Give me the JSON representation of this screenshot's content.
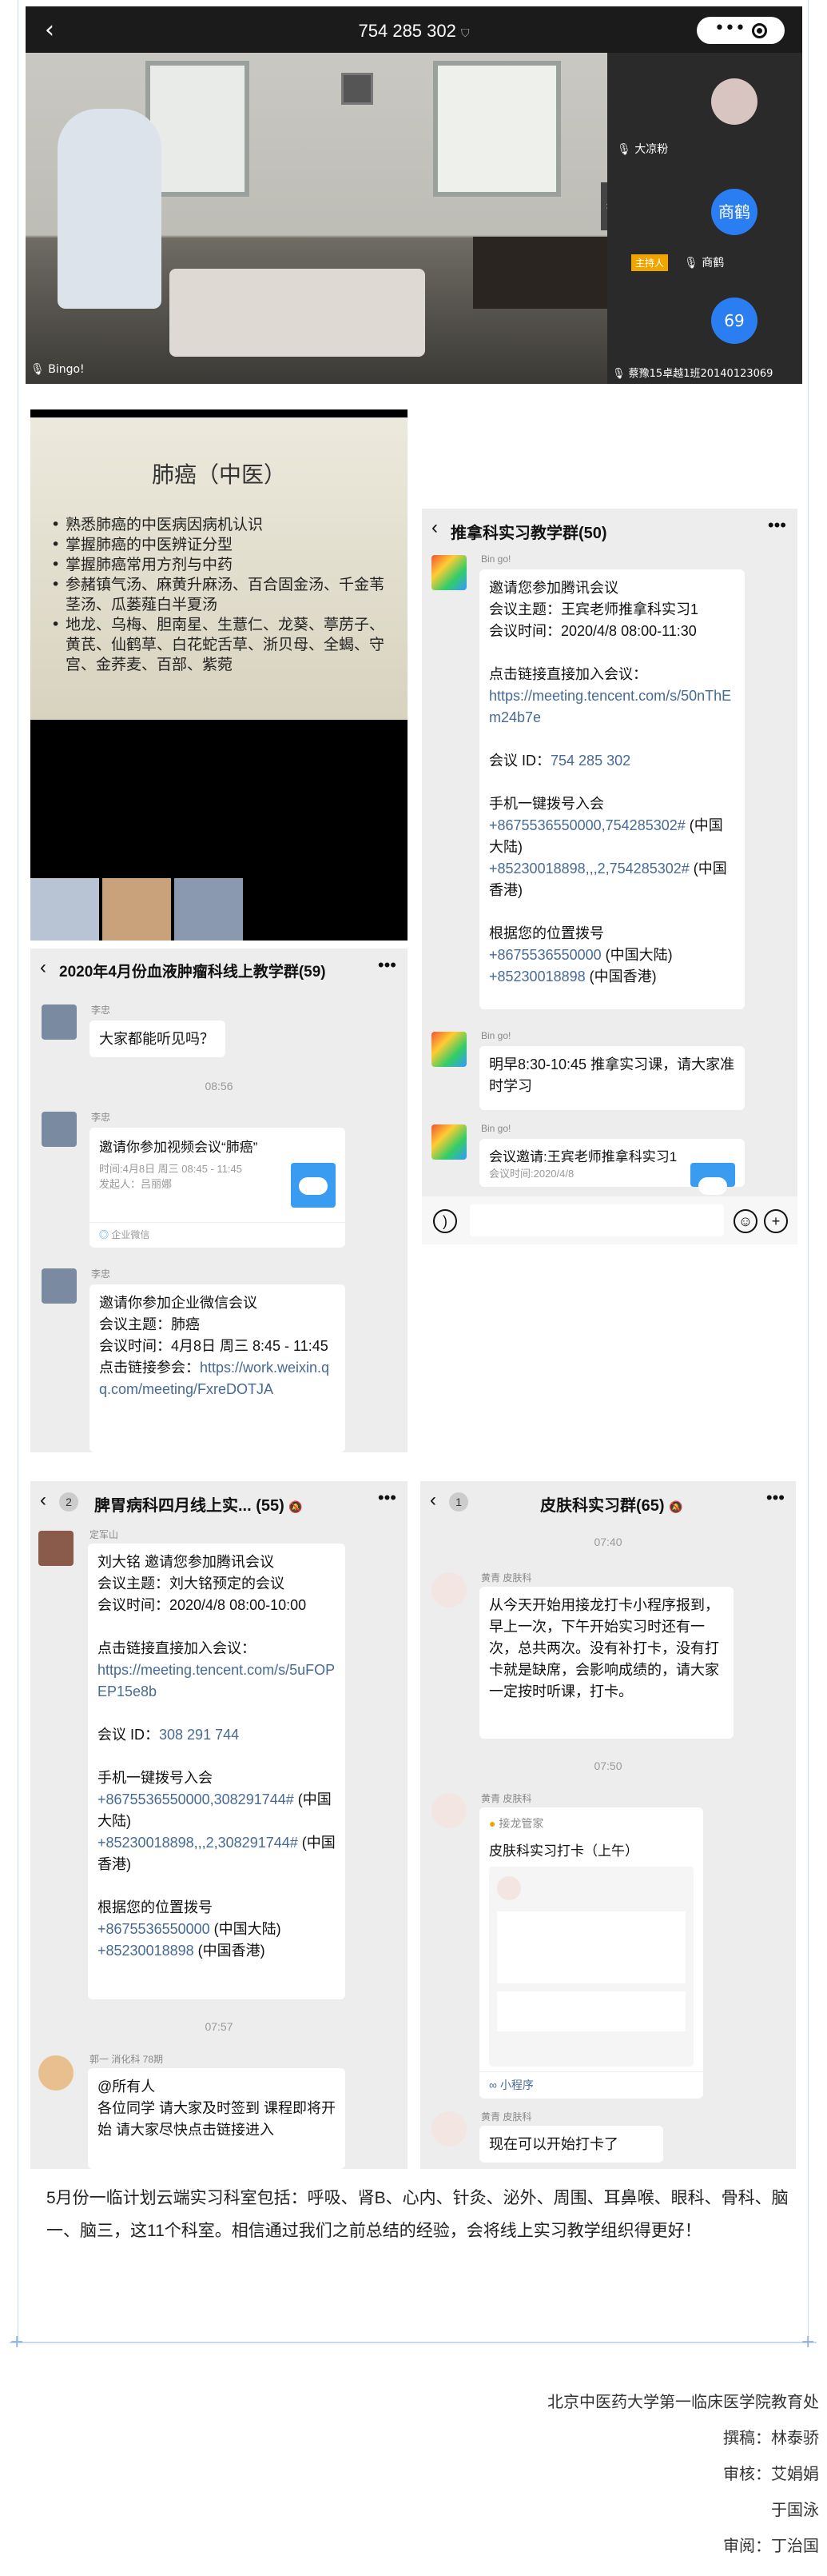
{
  "meeting": {
    "id_title": "754 285 302",
    "participants": [
      {
        "name": "大凉粉"
      },
      {
        "name": "商鹤",
        "avatar_text": "商鹤",
        "role_badge": "主持人"
      },
      {
        "name": "蔡豫15卓越1班20140123069",
        "avatar_text": "69"
      }
    ],
    "speaker_label": "Bingo!"
  },
  "slide": {
    "title": "肺癌（中医）",
    "bullets": [
      "熟悉肺癌的中医病因病机认识",
      "掌握肺癌的中医辨证分型",
      "掌握肺癌常用方剂与中药",
      "参赭镇气汤、麻黄升麻汤、百合固金汤、千金苇茎汤、瓜蒌薤白半夏汤",
      "地龙、乌梅、胆南星、生薏仁、龙葵、葶苈子、黄芪、仙鹤草、白花蛇舌草、浙贝母、全蝎、守宫、金荞麦、百部、紫菀"
    ]
  },
  "chat_tuina": {
    "title": "推拿科实习教学群(50)",
    "messages": [
      {
        "sender": "Bin go!",
        "lines": [
          "邀请您参加腾讯会议",
          "会议主题：王宾老师推拿科实习1",
          "会议时间：2020/4/8 08:00-11:30",
          "",
          "点击链接直接加入会议："
        ],
        "link": "https://meeting.tencent.com/s/50nThEm24b7e",
        "id_label": "会议 ID：",
        "id_value": "754 285 302",
        "dial_title": "手机一键拨号入会",
        "dial1": "+8675536550000,754285302#",
        "dial1_region": "(中国大陆)",
        "dial2": "+85230018898,,,2,754285302#",
        "dial2_region": "(中国香港)",
        "loc_title": "根据您的位置拨号",
        "loc1": "+8675536550000",
        "loc1_region": "(中国大陆)",
        "loc2": "+85230018898",
        "loc2_region": "(中国香港)"
      },
      {
        "sender": "Bin go!",
        "text": "明早8:30-10:45 推拿实习课，请大家准时学习"
      },
      {
        "sender": "Bin go!",
        "card_title": "会议邀请:王宾老师推拿科实习1",
        "card_sub": "会议时间:2020/4/8"
      }
    ]
  },
  "chat_blood": {
    "title": "2020年4月份血液肿瘤科线上教学群(59)",
    "messages": [
      {
        "sender": "李忠",
        "text": "大家都能听见吗？"
      },
      {
        "time": "08:56"
      },
      {
        "sender": "李忠",
        "card_title": "邀请你参加视频会议“肺癌”",
        "card_time": "时间:4月8日 周三 08:45 - 11:45",
        "card_from": "发起人：吕丽娜",
        "card_app": "企业微信"
      },
      {
        "sender": "李忠",
        "lines": [
          "邀请你参加企业微信会议",
          "会议主题：肺癌",
          "会议时间：4月8日 周三 8:45 - 11:45",
          "点击链接参会："
        ],
        "link": "https://work.weixin.qq.com/meeting/FxreDOTJA"
      }
    ]
  },
  "chat_spleen": {
    "badge": "2",
    "title": "脾胃病科四月线上实...",
    "count": "(55)",
    "messages": [
      {
        "sender": "定军山",
        "lines": [
          "刘大铭 邀请您参加腾讯会议",
          "会议主题：刘大铭预定的会议",
          "会议时间：2020/4/8 08:00-10:00",
          "",
          "点击链接直接加入会议："
        ],
        "link": "https://meeting.tencent.com/s/5uFOPEP15e8b",
        "id_label": "会议 ID：",
        "id_value": "308 291 744",
        "dial_title": "手机一键拨号入会",
        "dial1": "+8675536550000,308291744#",
        "dial1_region": "(中国大陆)",
        "dial2": "+85230018898,,,2,308291744#",
        "dial2_region": "(中国香港)",
        "loc_title": "根据您的位置拨号",
        "loc1": "+8675536550000",
        "loc1_region": "(中国大陆)",
        "loc2": "+85230018898",
        "loc2_region": "(中国香港)"
      },
      {
        "time": "07:57"
      },
      {
        "sender": "郭一 消化科 78期",
        "text": "@所有人\n各位同学 请大家及时签到 课程即将开始 请大家尽快点击链接进入"
      }
    ]
  },
  "chat_derm": {
    "badge": "1",
    "title": "皮肤科实习群(65)",
    "messages": [
      {
        "time": "07:40"
      },
      {
        "sender": "黄青 皮肤科",
        "text": "从今天开始用接龙打卡小程序报到，早上一次，下午开始实习时还有一次，总共两次。没有补打卡，没有打卡就是缺席，会影响成绩的，请大家一定按时听课，打卡。"
      },
      {
        "time": "07:50"
      },
      {
        "sender": "黄青 皮肤科",
        "app_name": "接龙管家",
        "card_title": "皮肤科实习打卡（上午）",
        "mini_label": "小程序"
      },
      {
        "sender": "黄青 皮肤科",
        "text": "现在可以开始打卡了"
      }
    ]
  },
  "description": "5月份一临计划云端实习科室包括：呼吸、肾B、心内、针灸、泌外、周围、耳鼻喉、眼科、骨科、脑一、脑三，这11个科室。相信通过我们之前总结的经验，会将线上实习教学组织得更好！",
  "footer": {
    "org": "北京中医药大学第一临床医学院教育处",
    "writer": "撰稿：林泰骄",
    "reviewer1": "审核：艾娟娟",
    "reviewer2": "于国泳",
    "approver": "审阅：丁治国"
  }
}
